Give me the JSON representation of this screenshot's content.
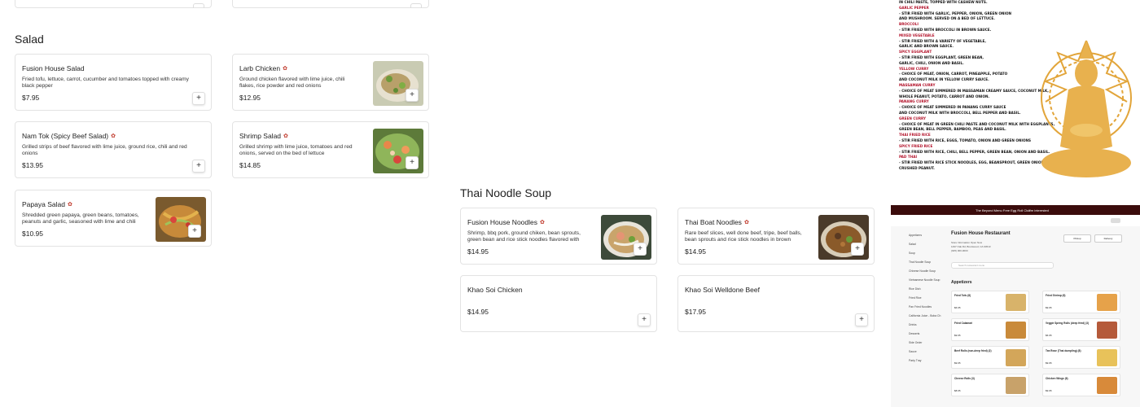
{
  "sections": {
    "salad": {
      "title": "Salad"
    },
    "noodle": {
      "title": "Thai Noodle Soup"
    }
  },
  "add_label": "+",
  "colors": {
    "chili": "#c0392b",
    "border": "#e3e3e3"
  },
  "salad_items": [
    {
      "name": "Fusion House Salad",
      "desc": "Fried tofu, lettuce, carrot, cucumber and tomatoes topped with creamy black pepper",
      "price": "$7.95",
      "spicy": false
    },
    {
      "name": "Larb Chicken",
      "desc": "Ground chicken flavored with lime juice, chili flakes, rice powder and red onions",
      "price": "$12.95",
      "spicy": true
    },
    {
      "name": "Nam Tok (Spicy Beef Salad)",
      "desc": "Grilled strips of beef flavored with lime juice, ground rice, chili and red onions",
      "price": "$13.95",
      "spicy": true
    },
    {
      "name": "Shrimp Salad",
      "desc": "Grilled shrimp with lime juice, tomatoes and red onions, served on the bed of lettuce",
      "price": "$14.85",
      "spicy": true
    },
    {
      "name": "Papaya Salad",
      "desc": "Shredded green papaya, green beans, tomatoes, peanuts and garlic, seasoned with lime and chili",
      "price": "$10.95",
      "spicy": true
    }
  ],
  "noodle_items": [
    {
      "name": "Fusion House Noodles",
      "desc": "Shrimp, bbq pork, ground chiken, bean sprouts, green bean and rice stick noodles flavored with",
      "price": "$14.95",
      "spicy": true
    },
    {
      "name": "Thai Boat Noodles",
      "desc": "Rare beef slices, well done beef, tripe, beef balls, bean sprouts and rice stick noodles in brown",
      "price": "$14.95",
      "spicy": true
    },
    {
      "name": "Khao Soi Chicken",
      "price": "$14.95"
    },
    {
      "name": "Khao Soi Welldone Beef",
      "price": "$17.95"
    }
  ],
  "poster": {
    "lines": [
      {
        "text": "IN CHILI PASTE, TOPPED WITH CASHEW NUTS.",
        "hd": false
      },
      {
        "text": "GARLIC PEPPER",
        "hd": true
      },
      {
        "text": "- STIR FRIED WITH GARLIC, PEPPER, ONION, GREEN ONION",
        "hd": false
      },
      {
        "text": "AND MUSHROOM. SERVED ON A BED OF LETTUCE.",
        "hd": false
      },
      {
        "text": "BROCCOLI",
        "hd": true
      },
      {
        "text": "- STIR FRIED WITH BROCCOLI IN BROWN SAUCE.",
        "hd": false
      },
      {
        "text": "MIXED VEGETABLE",
        "hd": true
      },
      {
        "text": "- STIR FRIED WITH A VARIETY OF VEGETABLE,",
        "hd": false
      },
      {
        "text": "GARLIC AND BROWN SAUCE.",
        "hd": false
      },
      {
        "text": "SPICY EGGPLANT",
        "hd": true
      },
      {
        "text": "- STIR FRIED WITH EGGPLANT, GREEN BEAN,",
        "hd": false
      },
      {
        "text": "GARLIC, CHILI, ONION AND BASIL.",
        "hd": false
      },
      {
        "text": "YELLOW CURRY",
        "hd": true
      },
      {
        "text": "- CHOICE OF MEAT, ONION, CARROT, PINEAPPLE, POTATO",
        "hd": false
      },
      {
        "text": "AND COCONUT MILK IN YELLOW CURRY SAUCE.",
        "hd": false
      },
      {
        "text": "MASSAMAN CURRY",
        "hd": true
      },
      {
        "text": "- CHOICE OF MEAT SIMMERED IN MASSAMAN CREAMY SAUCE, COCONUT MILK,",
        "hd": false
      },
      {
        "text": "WHOLE PEANUT, POTATO, CARROT AND ONION.",
        "hd": false
      },
      {
        "text": "PANANG CURRY",
        "hd": true
      },
      {
        "text": "- CHOICE OF MEAT SIMMERED IN PANANG CURRY SAUCE",
        "hd": false
      },
      {
        "text": "AND COCONUT MILK WITH BROCCOLI, BELL PEPPER AND BASIL.",
        "hd": false
      },
      {
        "text": "GREEN CURRY",
        "hd": true
      },
      {
        "text": "- CHOICE OF MEAT IN GREEN CHILI PASTE AND COCONUT MILK WITH EGGPLANTS,",
        "hd": false
      },
      {
        "text": "GREEN BEAN, BELL PEPPER, BAMBOO, PEAS AND BASIL.",
        "hd": false
      },
      {
        "text": "THAI FRIED RICE",
        "hd": true
      },
      {
        "text": "- STIR FRIED WITH RICE, EGGS, TOMATO, ONION AND GREEN ONIONS",
        "hd": false
      },
      {
        "text": "SPICY FRIED RICE",
        "hd": true
      },
      {
        "text": "- STIR FRIED WITH RICE, CHILI, BELL PEPPER, GREEN BEAN, ONION AND BASIL.",
        "hd": false
      },
      {
        "text": "PAD THAI",
        "hd": true
      },
      {
        "text": "- STIR FRIED WITH RICE STICK NOODLES, EGG, BEANSPROUT, GREEN ONION AND CRUSHED PEANUT.",
        "hd": false
      }
    ]
  },
  "banner": {
    "left": "The Beyond Menu Free Egg Roll Club",
    "right": "I'm interested"
  },
  "mini_site": {
    "title": "Fusion House Restaurant",
    "info": [
      "Store Information   Open Now",
      "1497 Oak Rd, Brentwood, CA 94513",
      "(925) 000-0000"
    ],
    "pickup": "Pickup",
    "delivery": "Delivery",
    "search_placeholder": "Search restaurant menu",
    "section": "Appetizers",
    "side_items": [
      "Appetizers",
      "Salad",
      "Soup",
      "Thai Noodle Soup",
      "Chinese Noodle Soup",
      "Vietnamese Noodle Soup",
      "Rice Dish",
      "Fried Rice",
      "Pan Fried Noodles",
      "California Juice - Boba Ch",
      "Drinks",
      "Desserts",
      "Side Order",
      "Sauce",
      "Party Tray"
    ],
    "cards": [
      {
        "t": "Fried Tofu (8)",
        "p": "$6.95"
      },
      {
        "t": "Fried Shrimp (6)",
        "p": "$9.95"
      },
      {
        "t": "Fried Calamari",
        "p": "$9.95"
      },
      {
        "t": "Veggie Spring Rolls (deep fried) (3)",
        "p": "$6.95"
      },
      {
        "t": "Beef Rolls (non-deep fried) (2)",
        "p": "$9.95"
      },
      {
        "t": "Tea Rose (Thai dumpling) (8)",
        "p": "$9.95"
      },
      {
        "t": "Cheese Rolls (3)",
        "p": "$8.95"
      },
      {
        "t": "Chicken Wings (6)",
        "p": "$9.95"
      }
    ]
  }
}
